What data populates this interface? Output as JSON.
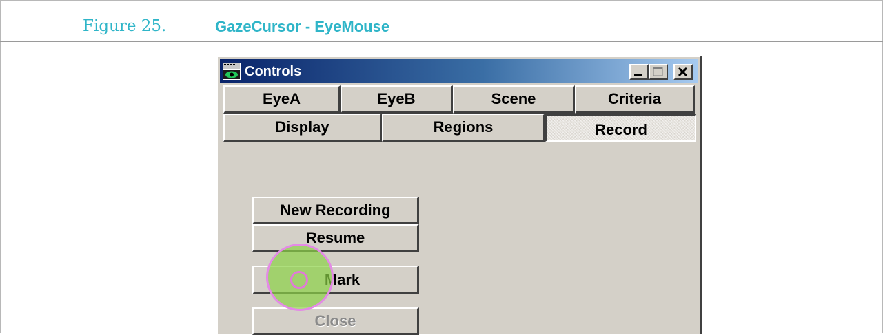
{
  "figure": {
    "number": "Figure 25.",
    "title": "GazeCursor - EyeMouse"
  },
  "window": {
    "title": "Controls",
    "icon": "eye-camera-icon",
    "controls": [
      "minimize-icon",
      "maximize-icon",
      "close-icon"
    ]
  },
  "tabs_row1": [
    "EyeA",
    "EyeB",
    "Scene",
    "Criteria"
  ],
  "tabs_row2": [
    "Display",
    "Regions",
    "Record"
  ],
  "active_tab": "Record",
  "buttons": {
    "new_recording": "New Recording",
    "resume": "Resume",
    "mark": "Mark",
    "close": "Close"
  },
  "gaze_cursor": {
    "icon": "gaze-cursor-icon",
    "colors": {
      "fill": "#8bd146",
      "ring": "#e38ae6"
    }
  },
  "colors": {
    "caption": "#2fb5c8",
    "face": "#d4d0c8",
    "titlebar_start": "#0a246a",
    "titlebar_end": "#a6caf0"
  }
}
